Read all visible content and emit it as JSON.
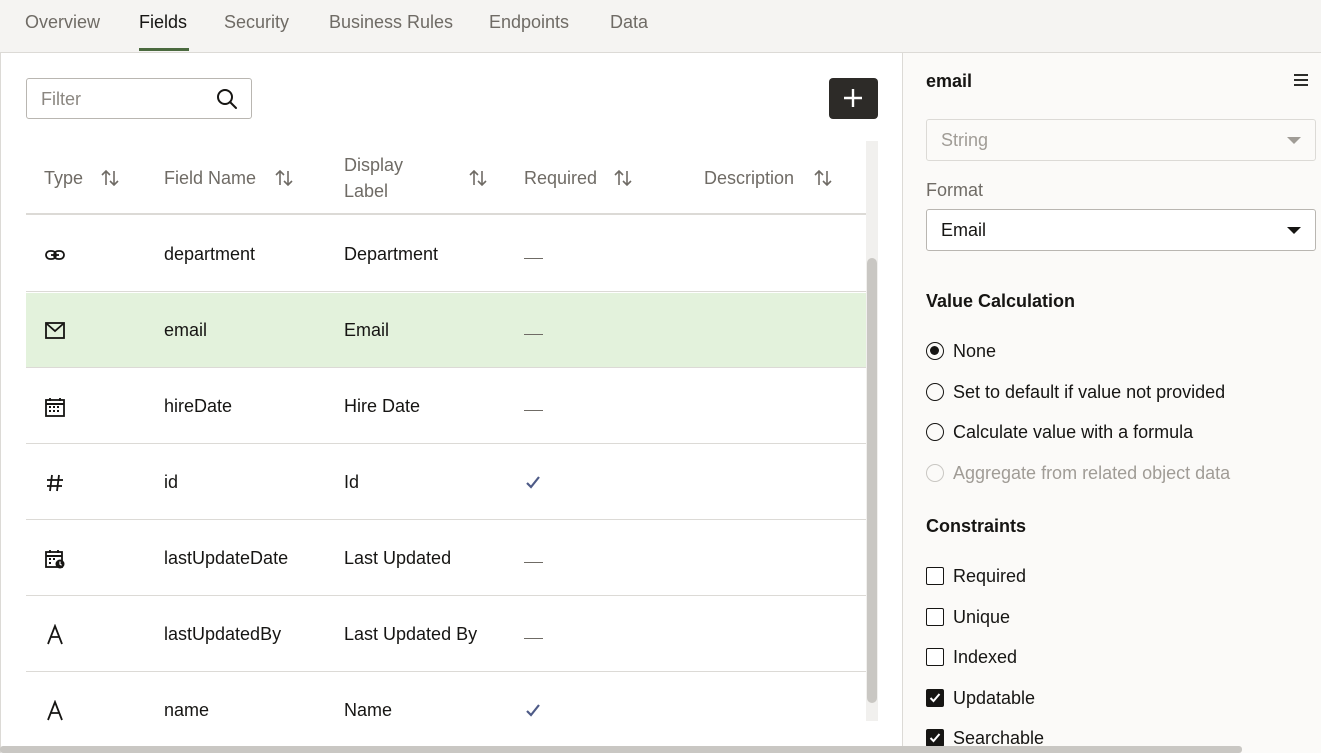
{
  "tabs": [
    {
      "label": "Overview",
      "active": false
    },
    {
      "label": "Fields",
      "active": true
    },
    {
      "label": "Security",
      "active": false
    },
    {
      "label": "Business Rules",
      "active": false
    },
    {
      "label": "Endpoints",
      "active": false
    },
    {
      "label": "Data",
      "active": false
    }
  ],
  "toolbar": {
    "filter_placeholder": "Filter",
    "filter_value": "",
    "add_icon": "plus-icon",
    "search_icon": "search-icon"
  },
  "table": {
    "columns": [
      {
        "label": "Type"
      },
      {
        "label": "Field Name"
      },
      {
        "label": "Display Label"
      },
      {
        "label": "Required"
      },
      {
        "label": "Description"
      }
    ],
    "rows": [
      {
        "type_icon": "link-icon",
        "name": "department",
        "label": "Department",
        "required": false,
        "description": "",
        "selected": false
      },
      {
        "type_icon": "email-icon",
        "name": "email",
        "label": "Email",
        "required": false,
        "description": "",
        "selected": true
      },
      {
        "type_icon": "calendar-icon",
        "name": "hireDate",
        "label": "Hire Date",
        "required": false,
        "description": "",
        "selected": false
      },
      {
        "type_icon": "number-icon",
        "name": "id",
        "label": "Id",
        "required": true,
        "description": "",
        "selected": false
      },
      {
        "type_icon": "datetime-icon",
        "name": "lastUpdateDate",
        "label": "Last Updated",
        "required": false,
        "description": "",
        "selected": false
      },
      {
        "type_icon": "text-icon",
        "name": "lastUpdatedBy",
        "label": "Last Updated By",
        "required": false,
        "description": "",
        "selected": false
      },
      {
        "type_icon": "text-icon",
        "name": "name",
        "label": "Name",
        "required": true,
        "description": "",
        "selected": false
      }
    ]
  },
  "panel": {
    "title": "email",
    "menu_icon": "hamburger-menu-icon",
    "type_value": "String",
    "format_label": "Format",
    "format_value": "Email",
    "value_calculation": {
      "title": "Value Calculation",
      "options": [
        {
          "label": "None",
          "checked": true,
          "disabled": false
        },
        {
          "label": "Set to default if value not provided",
          "checked": false,
          "disabled": false
        },
        {
          "label": "Calculate value with a formula",
          "checked": false,
          "disabled": false
        },
        {
          "label": "Aggregate from related object data",
          "checked": false,
          "disabled": true
        }
      ]
    },
    "constraints": {
      "title": "Constraints",
      "options": [
        {
          "label": "Required",
          "checked": false
        },
        {
          "label": "Unique",
          "checked": false
        },
        {
          "label": "Indexed",
          "checked": false
        },
        {
          "label": "Updatable",
          "checked": true
        },
        {
          "label": "Searchable",
          "checked": true
        }
      ]
    }
  },
  "colors": {
    "accent": "#4b6a3f",
    "selected_row": "#e3f2dc",
    "check": "#4e5b87"
  }
}
